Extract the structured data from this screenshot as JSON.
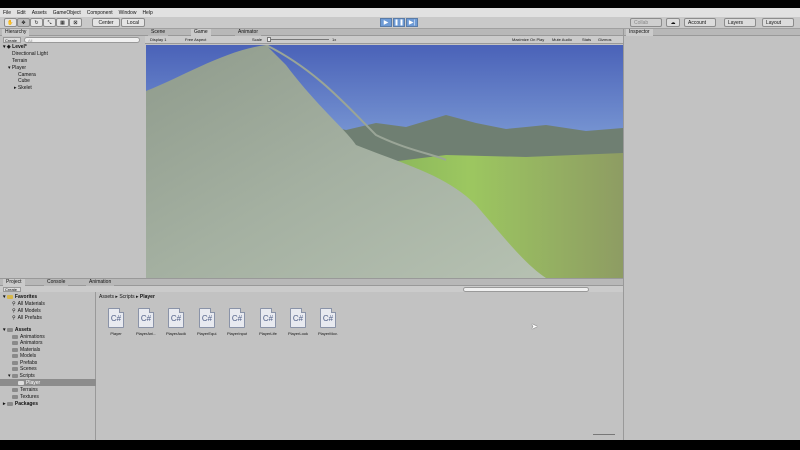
{
  "menu": [
    "File",
    "Edit",
    "Assets",
    "GameObject",
    "Component",
    "Window",
    "Help"
  ],
  "toolbar": {
    "pivot_label": "Center",
    "space_label": "Local",
    "collab_label": "Collab",
    "account_label": "Account",
    "layers_label": "Layers",
    "layout_label": "Layout"
  },
  "hierarchy": {
    "tab": "Hierarchy",
    "create_label": "Create",
    "search_placeholder": "All",
    "scene": "Level*",
    "items": [
      "Directional Light",
      "Terrain",
      "Player",
      "Camera",
      "Cube",
      "Skelet"
    ]
  },
  "game": {
    "tabs": [
      "Scene",
      "Game",
      "Animator"
    ],
    "display": "Display 1",
    "aspect": "Free Aspect",
    "scale_label": "Scale",
    "scale_value": "1x",
    "options": [
      "Maximize On Play",
      "Mute Audio",
      "Stats",
      "Gizmos"
    ]
  },
  "inspector": {
    "tab": "Inspector"
  },
  "project": {
    "tabs": [
      "Project",
      "Console",
      "Animation"
    ],
    "create_label": "Create",
    "favorites_label": "Favorites",
    "favorites": [
      "All Materials",
      "All Models",
      "All Prefabs"
    ],
    "assets_label": "Assets",
    "asset_folders": [
      "Animations",
      "Animators",
      "Materials",
      "Models",
      "Prefabs",
      "Scenes",
      "Scripts",
      "Player",
      "Terrains",
      "Textures"
    ],
    "packages_label": "Packages",
    "breadcrumb": [
      "Assets",
      "Scripts",
      "Player"
    ],
    "files": [
      "Player",
      "PlayerAni...",
      "PlayerAudio",
      "PlayerEqui...",
      "PlayerInput",
      "PlayerLife",
      "PlayerLook",
      "PlayerMov..."
    ],
    "file_icon": "C#"
  }
}
